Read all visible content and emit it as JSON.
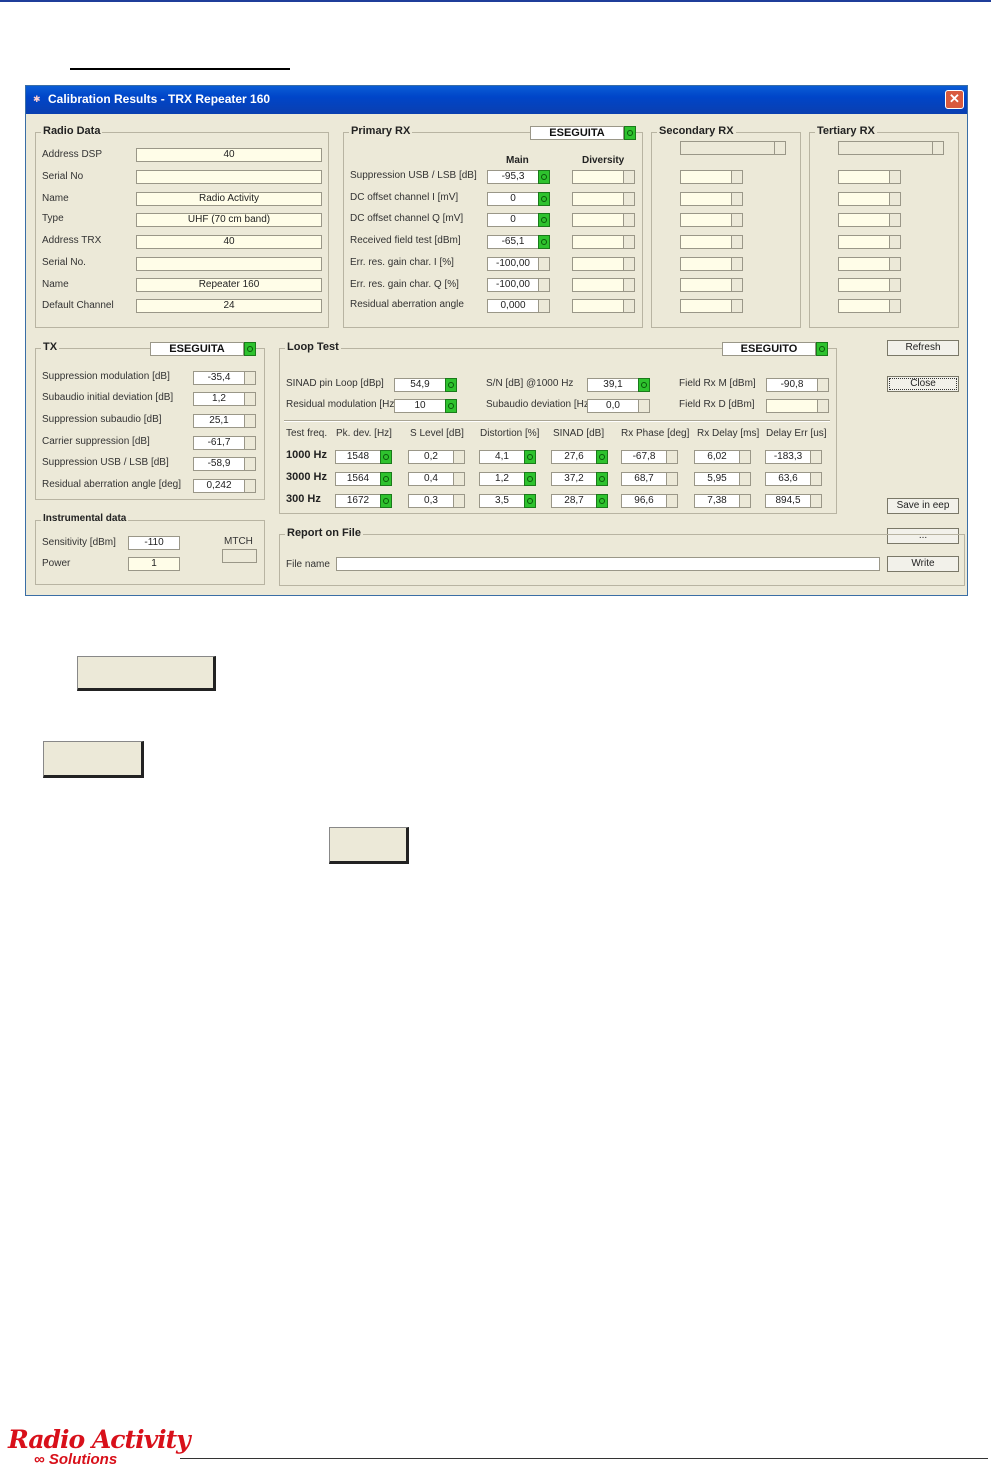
{
  "window": {
    "title": "Calibration Results - TRX Repeater 160",
    "close_glyph": "✕",
    "icon_glyph": "✱"
  },
  "radio_data": {
    "title": "Radio Data",
    "rows": [
      {
        "label": "Address DSP",
        "value": "40"
      },
      {
        "label": "Serial No",
        "value": ""
      },
      {
        "label": "Name",
        "value": "Radio Activity"
      },
      {
        "label": "Type",
        "value": "UHF (70 cm band)"
      },
      {
        "label": "Address TRX",
        "value": "40"
      },
      {
        "label": "Serial No.",
        "value": ""
      },
      {
        "label": "Name",
        "value": "Repeater 160"
      },
      {
        "label": "Default Channel",
        "value": "24"
      }
    ]
  },
  "primary_rx": {
    "title": "Primary RX",
    "status": "ESEGUITA",
    "col_main": "Main",
    "col_diversity": "Diversity",
    "rows": [
      {
        "label": "Suppression USB / LSB [dB]",
        "main": "-95,3",
        "ok": true
      },
      {
        "label": "DC offset channel I [mV]",
        "main": "0",
        "ok": true
      },
      {
        "label": "DC offset channel Q [mV]",
        "main": "0",
        "ok": true
      },
      {
        "label": "Received field test [dBm]",
        "main": "-65,1",
        "ok": true
      },
      {
        "label": "Err. res. gain char. I [%]",
        "main": "-100,00",
        "ok": false
      },
      {
        "label": "Err. res. gain char. Q [%]",
        "main": "-100,00",
        "ok": false
      },
      {
        "label": "Residual aberration angle",
        "main": "0,000",
        "ok": false
      }
    ]
  },
  "secondary_rx": {
    "title": "Secondary RX"
  },
  "tertiary_rx": {
    "title": "Tertiary RX"
  },
  "tx": {
    "title": "TX",
    "status": "ESEGUITA",
    "rows": [
      {
        "label": "Suppression modulation [dB]",
        "value": "-35,4"
      },
      {
        "label": "Subaudio initial deviation [dB]",
        "value": "1,2"
      },
      {
        "label": "Suppression subaudio [dB]",
        "value": "25,1"
      },
      {
        "label": "Carrier suppression [dB]",
        "value": "-61,7"
      },
      {
        "label": "Suppression USB / LSB [dB]",
        "value": "-58,9"
      },
      {
        "label": "Residual aberration angle [deg]",
        "value": "0,242"
      }
    ]
  },
  "loop_test": {
    "title": "Loop Test",
    "status": "ESEGUITO",
    "sinad_label": "SINAD pin Loop [dBp]",
    "sinad_value": "54,9",
    "resmod_label": "Residual modulation [Hz]",
    "resmod_value": "10",
    "sn_label": "S/N [dB] @1000 Hz",
    "sn_value": "39,1",
    "subdev_label": "Subaudio deviation [Hz]",
    "subdev_value": "0,0",
    "fieldm_label": "Field Rx M [dBm]",
    "fieldm_value": "-90,8",
    "fieldd_label": "Field Rx D [dBm]",
    "fieldd_value": "",
    "headers": [
      "Test freq.",
      "Pk. dev. [Hz]",
      "S Level [dB]",
      "Distortion [%]",
      "SINAD [dB]",
      "Rx Phase [deg]",
      "Rx Delay [ms]",
      "Delay Err [us]"
    ],
    "rows": [
      {
        "freq": "1000 Hz",
        "pk": "1548",
        "slevel": "0,2",
        "dist": "4,1",
        "sinad": "27,6",
        "phase": "-67,8",
        "delay": "6,02",
        "derr": "-183,3"
      },
      {
        "freq": "3000 Hz",
        "pk": "1564",
        "slevel": "0,4",
        "dist": "1,2",
        "sinad": "37,2",
        "phase": "68,7",
        "delay": "5,95",
        "derr": "63,6"
      },
      {
        "freq": "300 Hz",
        "pk": "1672",
        "slevel": "0,3",
        "dist": "3,5",
        "sinad": "28,7",
        "phase": "96,6",
        "delay": "7,38",
        "derr": "894,5"
      }
    ]
  },
  "instrumental": {
    "title": "Instrumental data",
    "sens_label": "Sensitivity [dBm]",
    "sens_value": "-110",
    "power_label": "Power",
    "power_value": "1",
    "match_label": "MTCH",
    "match_value": ""
  },
  "report": {
    "title": "Report on File",
    "file_label": "File name",
    "file_value": "",
    "write_label": "Write",
    "browse_label": "..."
  },
  "buttons": {
    "refresh": "Refresh",
    "close": "Close",
    "save_eep": "Save in eep"
  },
  "logo": {
    "main": "Radio Activity",
    "sub": "∞ Solutions"
  }
}
